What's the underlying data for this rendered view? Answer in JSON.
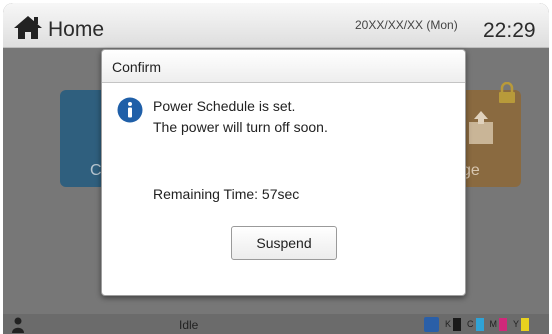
{
  "header": {
    "title": "Home",
    "date": "20XX/XX/XX (Mon)",
    "time": "22:29",
    "home_icon": "home-icon"
  },
  "background_tiles": {
    "left_label": "C",
    "right_label": "ge"
  },
  "dialog": {
    "title": "Confirm",
    "icon": "info-icon",
    "message_line1": "Power Schedule is set.",
    "message_line2": "The power will turn off soon.",
    "remaining": "Remaining Time: 57sec",
    "suspend_label": "Suspend"
  },
  "statusbar": {
    "status": "Idle",
    "toner": [
      {
        "label": "K",
        "color": "#1a1a1a"
      },
      {
        "label": "C",
        "color": "#2fa3d6"
      },
      {
        "label": "M",
        "color": "#d0287a"
      },
      {
        "label": "Y",
        "color": "#e8d21f"
      }
    ]
  },
  "colors": {
    "info_blue": "#1f5fa8",
    "tile_blue": "#2f5f7e",
    "tile_orange": "#8a6a40"
  }
}
